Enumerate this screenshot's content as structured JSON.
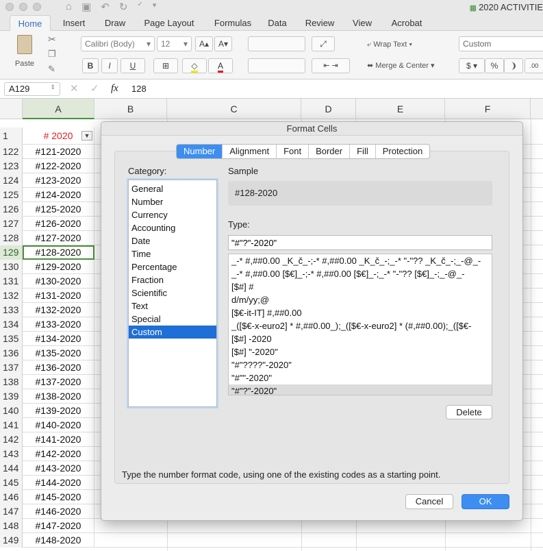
{
  "window": {
    "title": "2020 ACTIVITIE"
  },
  "ribbon_tabs": [
    "Home",
    "Insert",
    "Draw",
    "Page Layout",
    "Formulas",
    "Data",
    "Review",
    "View",
    "Acrobat"
  ],
  "ribbon": {
    "paste_label": "Paste",
    "font_name": "Calibri (Body)",
    "font_size": "12",
    "wrap_text": "Wrap Text",
    "merge_center": "Merge & Center",
    "number_format": "Custom",
    "currency_symbol": "$",
    "percent_symbol": "%",
    "bold": "B",
    "italic": "I",
    "underline": "U"
  },
  "formula_bar": {
    "cell_ref": "A129",
    "fx": "fx",
    "value": "128"
  },
  "columns": [
    "A",
    "B",
    "C",
    "D",
    "E",
    "F"
  ],
  "header_row": {
    "number": "1",
    "cell_a": "# 2020"
  },
  "rows": [
    {
      "n": "122",
      "a": "#121-2020"
    },
    {
      "n": "123",
      "a": "#122-2020"
    },
    {
      "n": "124",
      "a": "#123-2020"
    },
    {
      "n": "125",
      "a": "#124-2020"
    },
    {
      "n": "126",
      "a": "#125-2020"
    },
    {
      "n": "127",
      "a": "#126-2020"
    },
    {
      "n": "128",
      "a": "#127-2020"
    },
    {
      "n": "129",
      "a": "#128-2020"
    },
    {
      "n": "130",
      "a": "#129-2020"
    },
    {
      "n": "131",
      "a": "#130-2020"
    },
    {
      "n": "132",
      "a": "#131-2020"
    },
    {
      "n": "133",
      "a": "#132-2020"
    },
    {
      "n": "134",
      "a": "#133-2020"
    },
    {
      "n": "135",
      "a": "#134-2020"
    },
    {
      "n": "136",
      "a": "#135-2020"
    },
    {
      "n": "137",
      "a": "#136-2020"
    },
    {
      "n": "138",
      "a": "#137-2020"
    },
    {
      "n": "139",
      "a": "#138-2020"
    },
    {
      "n": "140",
      "a": "#139-2020"
    },
    {
      "n": "141",
      "a": "#140-2020"
    },
    {
      "n": "142",
      "a": "#141-2020"
    },
    {
      "n": "143",
      "a": "#142-2020"
    },
    {
      "n": "144",
      "a": "#143-2020"
    },
    {
      "n": "145",
      "a": "#144-2020"
    },
    {
      "n": "146",
      "a": "#145-2020"
    },
    {
      "n": "147",
      "a": "#146-2020"
    },
    {
      "n": "148",
      "a": "#147-2020"
    },
    {
      "n": "149",
      "a": "#148-2020"
    }
  ],
  "dialog": {
    "title": "Format Cells",
    "tabs": [
      "Number",
      "Alignment",
      "Font",
      "Border",
      "Fill",
      "Protection"
    ],
    "category_label": "Category:",
    "categories": [
      "General",
      "Number",
      "Currency",
      "Accounting",
      "Date",
      "Time",
      "Percentage",
      "Fraction",
      "Scientific",
      "Text",
      "Special",
      "Custom"
    ],
    "selected_category": "Custom",
    "sample_label": "Sample",
    "sample_value": "#128-2020",
    "type_label": "Type:",
    "type_value": "\"#\"?\"-2020\"",
    "formats": [
      "_-* #,##0.00 _K_č_-;-* #,##0.00 _K_č_-;_-* \"-\"?? _K_č_-;_-@_-",
      "_-* #,##0.00 [$€]_-;-* #,##0.00 [$€]_-;_-* \"-\"?? [$€]_-;_-@_-",
      "[$#] #",
      "d/m/yy;@",
      "[$€-it-IT] #,##0.00",
      "_([$€-x-euro2] * #,##0.00_);_([$€-x-euro2] * (#,##0.00);_([$€-",
      "[$#] -2020",
      "[$#] \"-2020\"",
      "\"#\"????\"-2020\"",
      "\"#\"\"-2020\"",
      "\"#\"?\"-2020\""
    ],
    "selected_format_index": 10,
    "delete_button": "Delete",
    "hint": "Type the number format code, using one of the existing codes as a starting point.",
    "cancel_button": "Cancel",
    "ok_button": "OK"
  },
  "colors": {
    "accent": "#3d8ef0",
    "header_red": "#e02020",
    "selected_category": "#1f6fd6"
  }
}
